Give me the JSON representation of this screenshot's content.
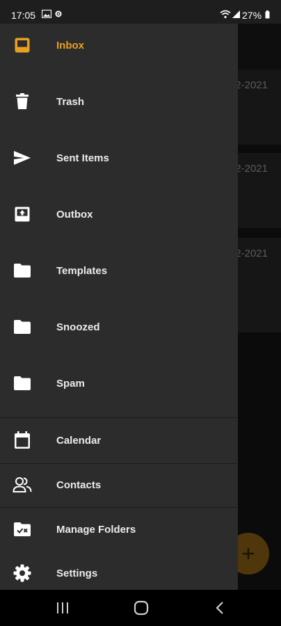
{
  "status_bar": {
    "time": "17:05",
    "battery": "27%",
    "icons": [
      "gallery-icon",
      "settings-icon",
      "wifi-icon",
      "signal-icon",
      "battery-icon"
    ]
  },
  "background": {
    "dates": [
      "2-2021",
      "2-2021",
      "2-2021"
    ],
    "fab_icon": "plus-icon"
  },
  "drawer": {
    "accent_color": "#e8a020",
    "items": [
      {
        "label": "Inbox",
        "icon": "inbox-icon",
        "active": true
      },
      {
        "label": "Trash",
        "icon": "trash-icon",
        "active": false
      },
      {
        "label": "Sent Items",
        "icon": "send-icon",
        "active": false
      },
      {
        "label": "Outbox",
        "icon": "outbox-icon",
        "active": false
      },
      {
        "label": "Templates",
        "icon": "folder-icon",
        "active": false
      },
      {
        "label": "Snoozed",
        "icon": "folder-icon",
        "active": false
      },
      {
        "label": "Spam",
        "icon": "folder-icon",
        "active": false
      },
      {
        "label": "Calendar",
        "icon": "calendar-icon",
        "active": false
      },
      {
        "label": "Contacts",
        "icon": "contacts-icon",
        "active": false
      },
      {
        "label": "Manage Folders",
        "icon": "manage-folders-icon",
        "active": false
      },
      {
        "label": "Settings",
        "icon": "gear-icon",
        "active": false
      }
    ]
  },
  "nav_bar": {
    "buttons": [
      "recents-button",
      "home-button",
      "back-button"
    ]
  }
}
